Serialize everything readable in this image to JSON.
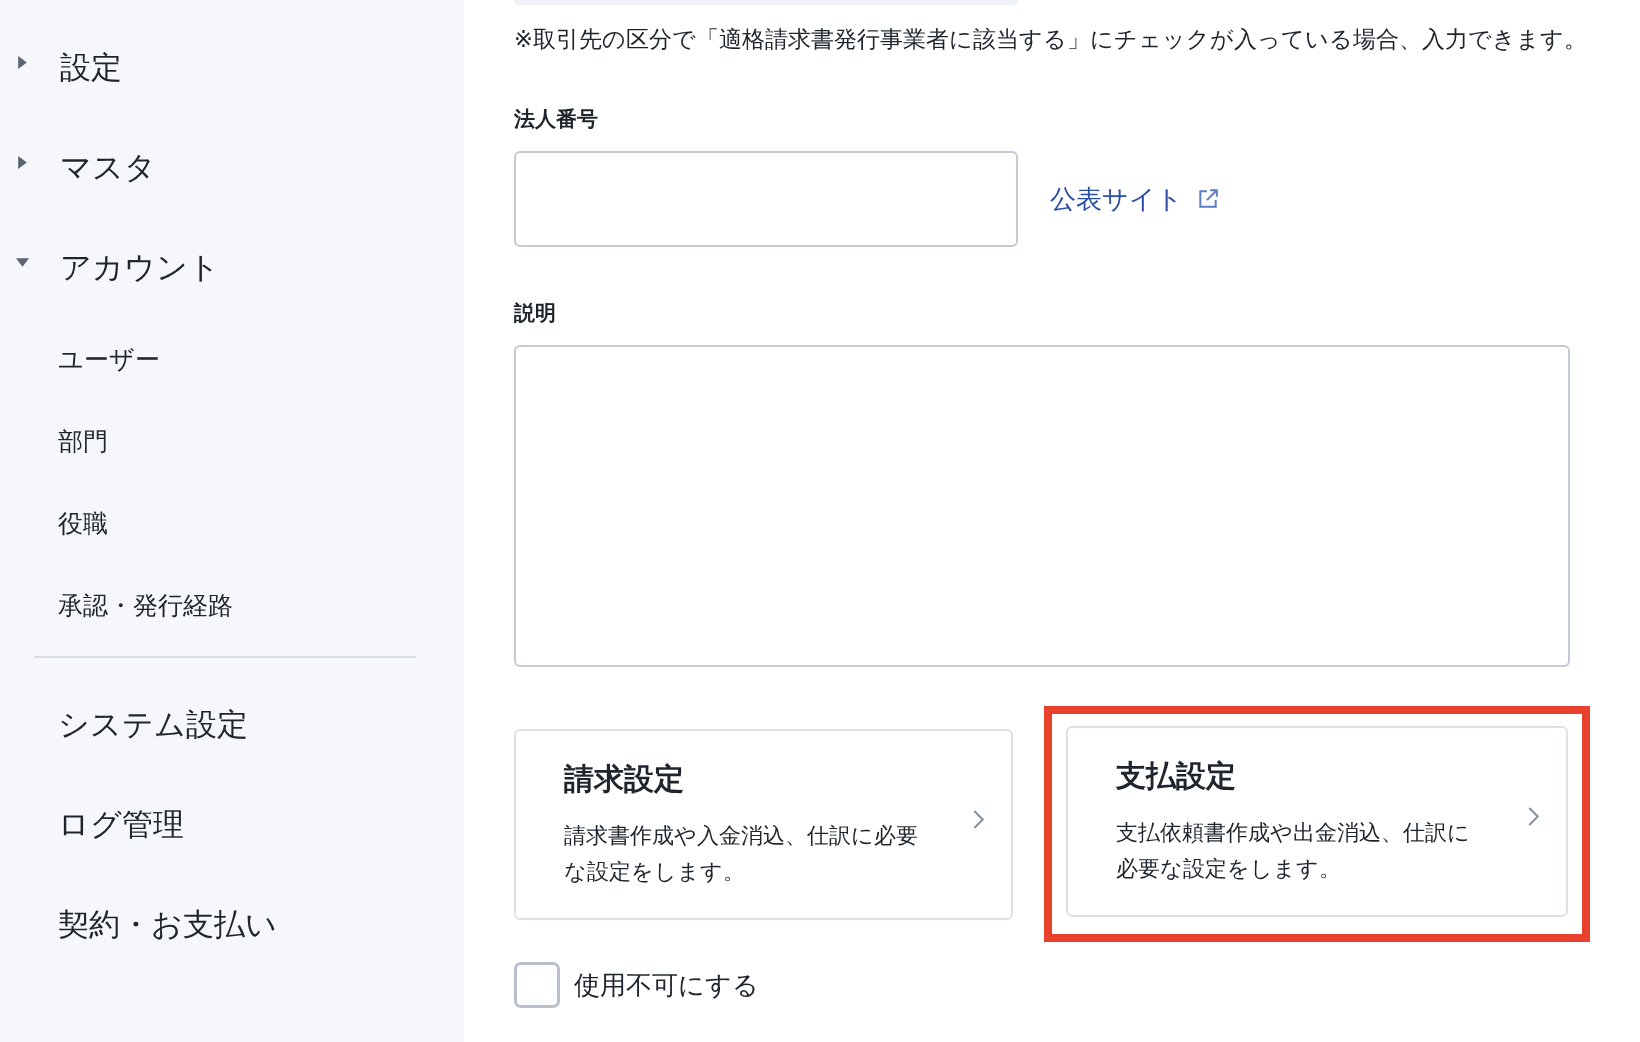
{
  "sidebar": {
    "groups": [
      {
        "label": "設定",
        "expanded": false
      },
      {
        "label": "マスタ",
        "expanded": false
      },
      {
        "label": "アカウント",
        "expanded": true,
        "children": [
          {
            "label": "ユーザー"
          },
          {
            "label": "部門"
          },
          {
            "label": "役職"
          },
          {
            "label": "承認・発行経路"
          }
        ]
      }
    ],
    "links": [
      {
        "label": "システム設定"
      },
      {
        "label": "ログ管理"
      },
      {
        "label": "契約・お支払い"
      }
    ]
  },
  "form": {
    "notice": "※取引先の区分で「適格請求書発行事業者に該当する」にチェックが入っている場合、入力できます。",
    "corporate_number": {
      "label": "法人番号",
      "link": "公表サイト"
    },
    "description": {
      "label": "説明"
    },
    "cards": [
      {
        "title": "請求設定",
        "text": "請求書作成や入金消込、仕訳に必要な設定をします。",
        "highlighted": false
      },
      {
        "title": "支払設定",
        "text": "支払依頼書作成や出金消込、仕訳に必要な設定をします。",
        "highlighted": true
      }
    ],
    "disable": {
      "label": "使用不可にする",
      "checked": false
    }
  }
}
